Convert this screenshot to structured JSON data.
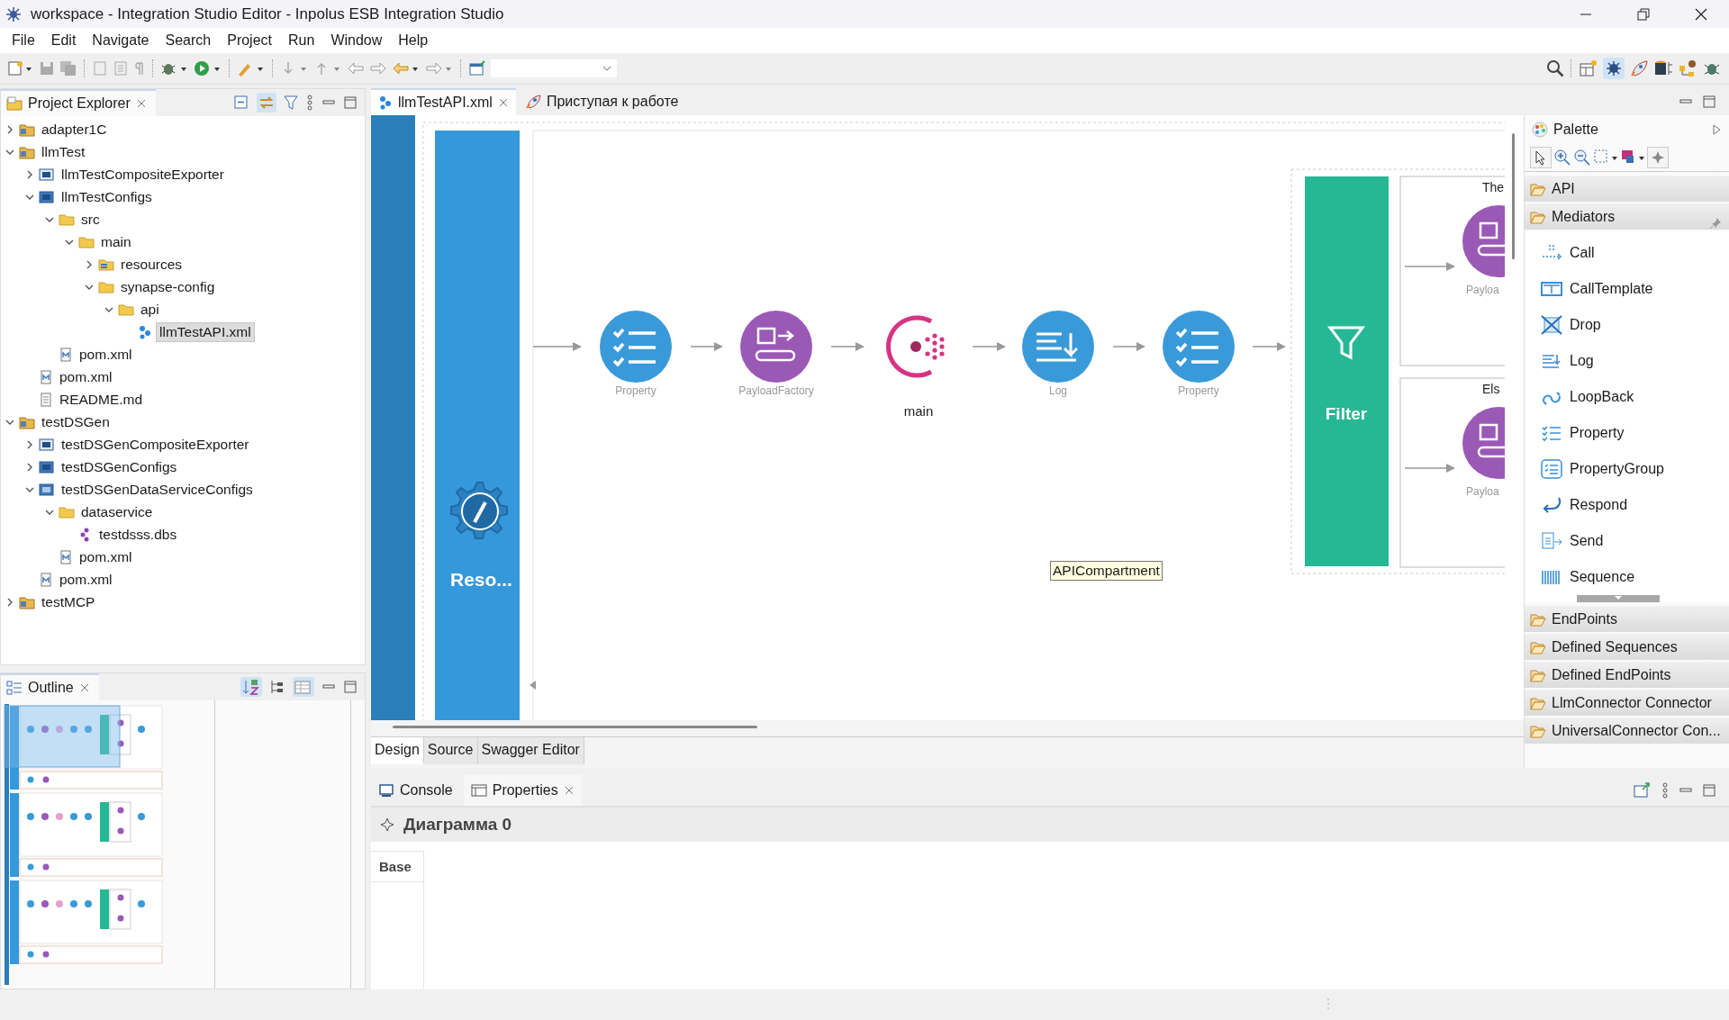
{
  "window": {
    "title": "workspace - Integration Studio Editor - Inpolus ESB Integration Studio"
  },
  "menu": [
    "File",
    "Edit",
    "Navigate",
    "Search",
    "Project",
    "Run",
    "Window",
    "Help"
  ],
  "project_explorer": {
    "title": "Project Explorer",
    "selected": true,
    "tree": [
      {
        "label": "adapter1C",
        "kind": "project",
        "expanded": false,
        "selected": false
      },
      {
        "label": "llmTest",
        "kind": "project",
        "expanded": true,
        "selected": false,
        "children": [
          {
            "label": "llmTestCompositeExporter",
            "kind": "composite",
            "expanded": false,
            "selected": false
          },
          {
            "label": "llmTestConfigs",
            "kind": "configs",
            "expanded": true,
            "selected": false,
            "children": [
              {
                "label": "src",
                "kind": "folder",
                "expanded": true,
                "selected": false,
                "children": [
                  {
                    "label": "main",
                    "kind": "folder",
                    "expanded": true,
                    "selected": false,
                    "children": [
                      {
                        "label": "resources",
                        "kind": "resources",
                        "expanded": false,
                        "selected": false
                      },
                      {
                        "label": "synapse-config",
                        "kind": "folder",
                        "expanded": true,
                        "selected": false,
                        "children": [
                          {
                            "label": "api",
                            "kind": "folder",
                            "expanded": true,
                            "selected": false,
                            "children": [
                              {
                                "label": "llmTestAPI.xml",
                                "kind": "xml",
                                "selected": true
                              }
                            ]
                          }
                        ]
                      }
                    ]
                  }
                ]
              },
              {
                "label": "pom.xml",
                "kind": "maven",
                "selected": false
              }
            ]
          },
          {
            "label": "pom.xml",
            "kind": "maven",
            "selected": false
          },
          {
            "label": "README.md",
            "kind": "doc",
            "selected": false
          }
        ]
      },
      {
        "label": "testDSGen",
        "kind": "project",
        "expanded": true,
        "selected": false,
        "children": [
          {
            "label": "testDSGenCompositeExporter",
            "kind": "composite",
            "expanded": false,
            "selected": false
          },
          {
            "label": "testDSGenConfigs",
            "kind": "configs",
            "expanded": false,
            "selected": false
          },
          {
            "label": "testDSGenDataServiceConfigs",
            "kind": "dsconfigs",
            "expanded": true,
            "selected": false,
            "children": [
              {
                "label": "dataservice",
                "kind": "folder",
                "expanded": true,
                "selected": false,
                "children": [
                  {
                    "label": "testdsss.dbs",
                    "kind": "dbs",
                    "selected": false
                  }
                ]
              },
              {
                "label": "pom.xml",
                "kind": "maven",
                "selected": false
              }
            ]
          },
          {
            "label": "pom.xml",
            "kind": "maven",
            "selected": false
          }
        ]
      },
      {
        "label": "testMCP",
        "kind": "project",
        "expanded": false,
        "selected": false
      }
    ]
  },
  "outline": {
    "title": "Outline",
    "selected": true
  },
  "editor": {
    "tabs": [
      {
        "label": "llmTestAPI.xml",
        "kind": "xml",
        "selected": true
      },
      {
        "label": "Приступая к работе",
        "kind": "welcome",
        "selected": false
      }
    ],
    "diagram": {
      "resource_label": "Reso...",
      "nodes": [
        {
          "kind": "property",
          "label": "Property"
        },
        {
          "kind": "payload",
          "label": "PayloadFactory"
        },
        {
          "kind": "sequence",
          "label": "main"
        },
        {
          "kind": "log",
          "label": "Log"
        },
        {
          "kind": "property",
          "label": "Property"
        }
      ],
      "filter": {
        "label": "Filter",
        "branches": [
          {
            "label": "The",
            "node_label": "Payloa"
          },
          {
            "label": "Els",
            "node_label": "Payloa"
          }
        ]
      },
      "tooltip": "APICompartment"
    },
    "view_tabs": [
      {
        "label": "Design",
        "selected": true
      },
      {
        "label": "Source",
        "selected": false
      },
      {
        "label": "Swagger Editor",
        "selected": false
      }
    ]
  },
  "palette": {
    "title": "Palette",
    "drawers": [
      {
        "label": "API"
      },
      {
        "label": "Mediators",
        "pinned": true,
        "items": [
          {
            "label": "Call",
            "kind": "call"
          },
          {
            "label": "CallTemplate",
            "kind": "calltemplate"
          },
          {
            "label": "Drop",
            "kind": "drop"
          },
          {
            "label": "Log",
            "kind": "log"
          },
          {
            "label": "LoopBack",
            "kind": "loopback"
          },
          {
            "label": "Property",
            "kind": "property"
          },
          {
            "label": "PropertyGroup",
            "kind": "propertygroup"
          },
          {
            "label": "Respond",
            "kind": "respond"
          },
          {
            "label": "Send",
            "kind": "send"
          },
          {
            "label": "Sequence",
            "kind": "sequence"
          }
        ]
      },
      {
        "label": "EndPoints"
      },
      {
        "label": "Defined Sequences"
      },
      {
        "label": "Defined EndPoints"
      },
      {
        "label": "LlmConnector Connector"
      },
      {
        "label": "UniversalConnector Con..."
      }
    ]
  },
  "bottom_panel": {
    "tabs": [
      {
        "label": "Console",
        "kind": "console",
        "selected": false
      },
      {
        "label": "Properties",
        "kind": "properties",
        "selected": true
      }
    ],
    "heading": "Диаграмма 0",
    "sections": [
      {
        "label": "Base",
        "selected": true
      }
    ]
  }
}
